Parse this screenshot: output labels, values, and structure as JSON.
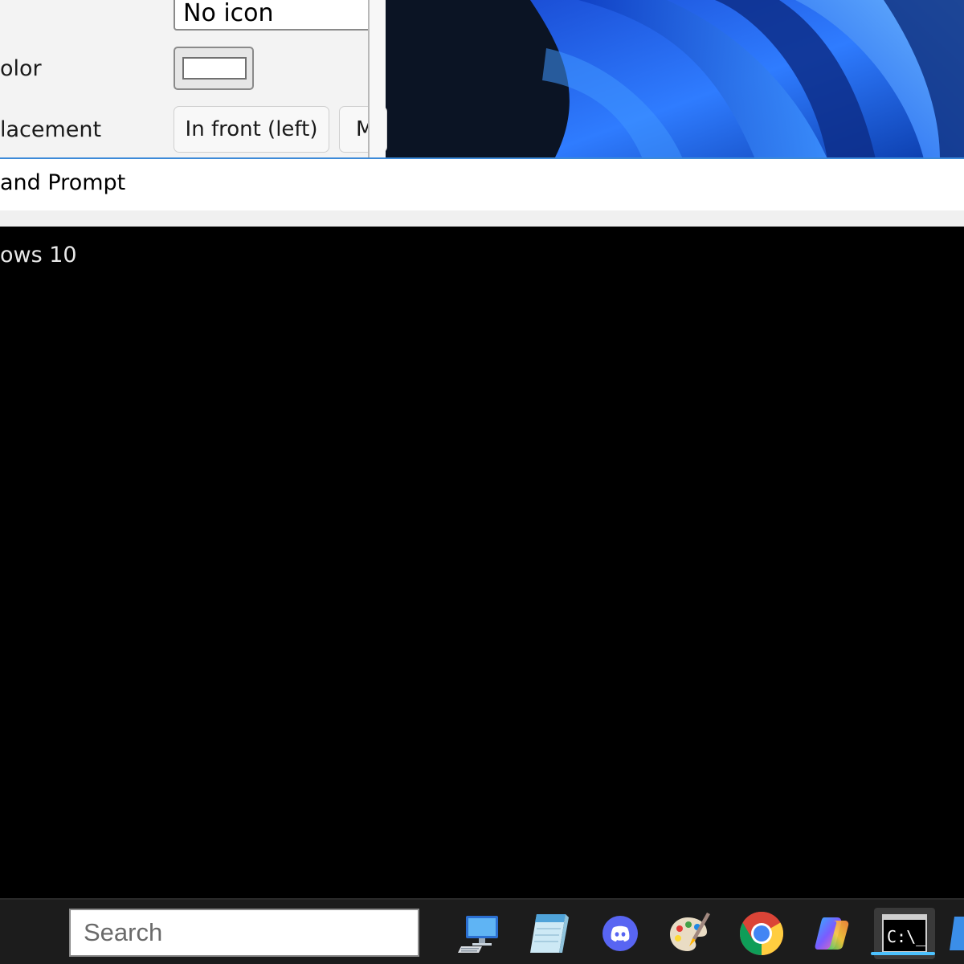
{
  "dialog": {
    "icon_value": "No icon",
    "color_label": "olor",
    "placement_label": "lacement",
    "placement_button_1": "In front (left)",
    "placement_button_2": "M"
  },
  "cmd": {
    "title": "and Prompt",
    "console_line": "ows 10"
  },
  "taskbar": {
    "search_placeholder": "Search",
    "apps": [
      "this-pc",
      "notepad",
      "discord",
      "paint",
      "chrome",
      "copilot",
      "command-prompt"
    ],
    "cmd_icon_text": "C:\\_"
  },
  "colors": {
    "accent": "#4cc2ff",
    "window_border": "#3c8ad8",
    "wallpaper_blue": "#1e6cf0"
  }
}
